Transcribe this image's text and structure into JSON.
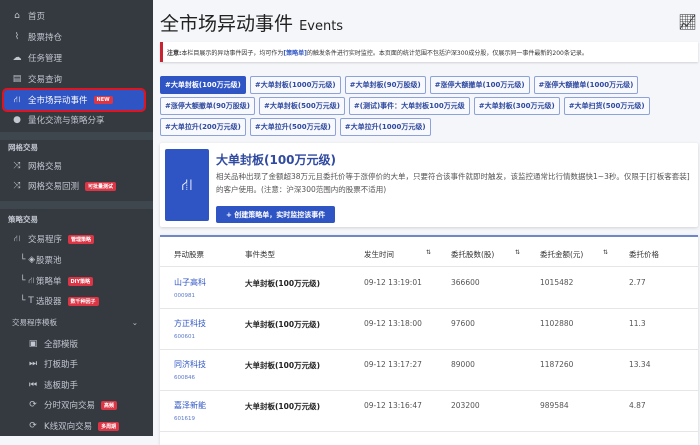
{
  "sidebar": {
    "items": [
      {
        "label": "首页",
        "icon": "home-icon"
      },
      {
        "label": "股票持仓",
        "icon": "chart-line-icon"
      },
      {
        "label": "任务管理",
        "icon": "cloud-icon"
      },
      {
        "label": "交易查询",
        "icon": "table-icon"
      },
      {
        "label": "全市场异动事件",
        "icon": "sitemap-icon",
        "badge": "NEW"
      },
      {
        "label": "量化交流与策略分享",
        "icon": "comments-icon"
      }
    ],
    "grid_header": "网格交易",
    "grid_items": [
      {
        "label": "网格交易",
        "icon": "shuffle-icon"
      },
      {
        "label": "网格交易回测",
        "icon": "shuffle-icon",
        "badge": "可批量测试"
      }
    ],
    "strategy_header": "策略交易",
    "strategy_items": [
      {
        "label": "交易程序",
        "badge": "管理策略"
      },
      {
        "label": "股票池"
      },
      {
        "label": "策略单",
        "badge": "DIY策略"
      },
      {
        "label": "选股器",
        "badge": "数千种因子"
      }
    ],
    "template_header": "交易程序模板",
    "template_items": [
      {
        "label": "全部模版"
      },
      {
        "label": "打板助手"
      },
      {
        "label": "逃板助手"
      },
      {
        "label": "分时双向交易",
        "badge": "高频"
      },
      {
        "label": "K线双向交易",
        "badge": "多周期"
      }
    ]
  },
  "page": {
    "title": "全市场异动事件",
    "subtitle": "Events"
  },
  "notice": {
    "prefix": "注意:",
    "text1": "本栏目展示的异动事件因子，均可作为",
    "link": "[策略单]",
    "text2": "的触发条件进行实时监控。本页面的统计范围不包括沪深300成分股，仅展示同一事件最新的200条记录。"
  },
  "tags": [
    "#大单封板(100万元级)",
    "#大单封板(1000万元级)",
    "#大单封板(90万股级)",
    "#涨停大额撤单(100万元级)",
    "#涨停大额撤单(1000万元级)",
    "#涨停大额撤单(90万股级)",
    "#大单封板(500万元级)",
    "#(测试)事件：大单封板100万元级",
    "#大单封板(300万元级)",
    "#大单扫货(500万元级)",
    "#大单拉升(200万元级)",
    "#大单拉升(500万元级)",
    "#大单拉升(1000万元级)"
  ],
  "event": {
    "title": "大单封板(100万元级)",
    "description": "相关品种出现了金额超38万元且委托价等于涨停价的大单，只要符合该事件就即时触发，该监控通常比行情数据快1~3秒。仅限于[打板客套装]的客户使用。(注意：沪深300范围内的股票不适用)",
    "button": "+ 创建策略单，实时监控该事件"
  },
  "table": {
    "headers": [
      "异动股票",
      "事件类型",
      "发生时间",
      "委托股数(股)",
      "委托金额(元)",
      "委托价格"
    ],
    "rows": [
      {
        "name": "山子高科",
        "code": "000981",
        "type": "大单封板(100万元级)",
        "time": "09-12 13:19:01",
        "shares": "366600",
        "amount": "1015482",
        "price": "2.77"
      },
      {
        "name": "方正科技",
        "code": "600601",
        "type": "大单封板(100万元级)",
        "time": "09-12 13:18:00",
        "shares": "97600",
        "amount": "1102880",
        "price": "11.3"
      },
      {
        "name": "同济科技",
        "code": "600846",
        "type": "大单封板(100万元级)",
        "time": "09-12 13:17:27",
        "shares": "89000",
        "amount": "1187260",
        "price": "13.34"
      },
      {
        "name": "嘉泽新能",
        "code": "601619",
        "type": "大单封板(100万元级)",
        "time": "09-12 13:16:47",
        "shares": "203200",
        "amount": "989584",
        "price": "4.87"
      }
    ]
  }
}
